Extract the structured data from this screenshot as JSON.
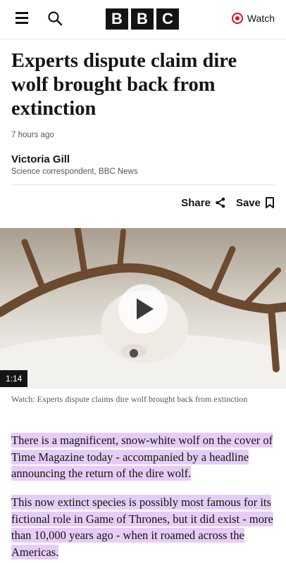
{
  "header": {
    "logo_letters": [
      "B",
      "B",
      "C"
    ],
    "watch_label": "Watch",
    "accent_color": "#d4191b"
  },
  "article": {
    "headline": "Experts dispute claim dire wolf brought back from extinction",
    "timestamp": "7 hours ago",
    "author": "Victoria Gill",
    "author_role": "Science correspondent, BBC News",
    "share_label": "Share",
    "save_label": "Save"
  },
  "video": {
    "duration": "1:14",
    "caption": "Watch: Experts dispute claims dire wolf brought back from extinction"
  },
  "body": {
    "paragraphs": [
      "There is a magnificent, snow-white wolf on the cover of Time Magazine today - accompanied by a headline announcing the return of the dire wolf.",
      "This now extinct species is possibly most famous for its fictional role in Game of Thrones, but it did exist - more than 10,000 years ago - when it roamed across the Americas."
    ],
    "highlight_color": "#e6cdf5"
  },
  "icons": [
    "menu-icon",
    "search-icon",
    "live-dot-icon",
    "share-icon",
    "bookmark-icon",
    "play-icon"
  ]
}
